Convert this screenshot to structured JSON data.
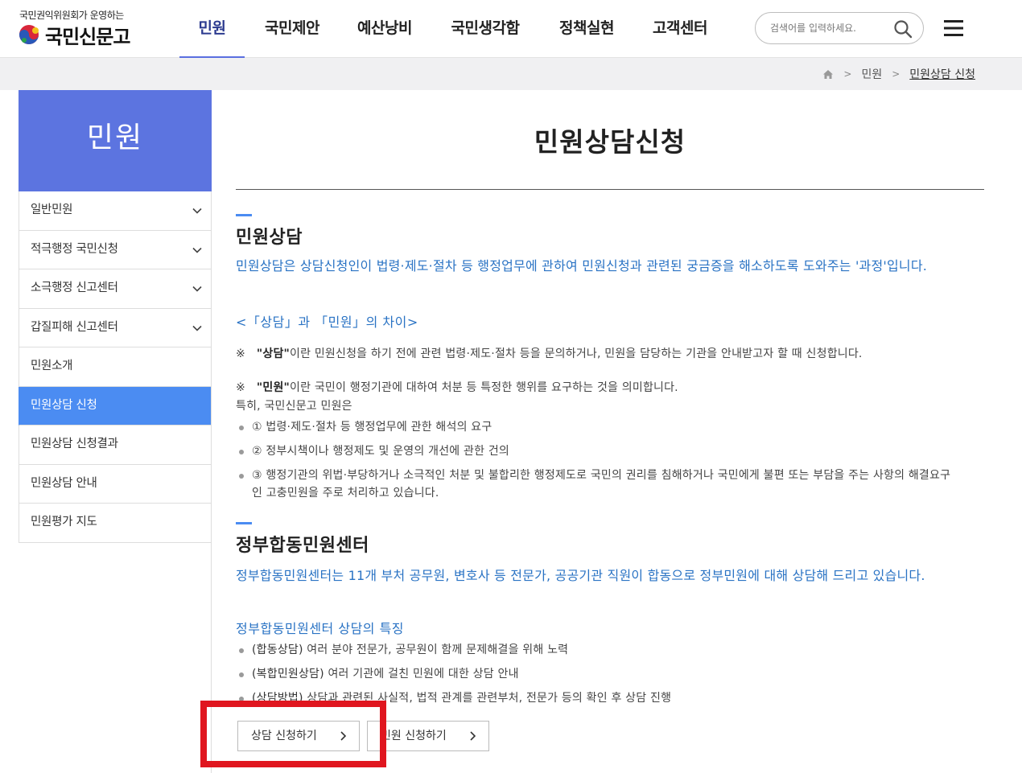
{
  "logo": {
    "subtitle": "국민권익위원회가 운영하는",
    "name": "국민신문고"
  },
  "nav": {
    "items": [
      {
        "label": "민원",
        "active": true
      },
      {
        "label": "국민제안",
        "active": false
      },
      {
        "label": "예산낭비",
        "active": false
      },
      {
        "label": "국민생각함",
        "active": false
      },
      {
        "label": "정책실현",
        "active": false
      },
      {
        "label": "고객센터",
        "active": false
      }
    ]
  },
  "search": {
    "placeholder": "검색어를 입력하세요.",
    "icon": "search-icon"
  },
  "breadcrumb": {
    "home_icon": "home-icon",
    "level1": "민원",
    "current": "민원상담 신청"
  },
  "sidebar": {
    "title": "민원",
    "items": [
      {
        "label": "일반민원",
        "expandable": true
      },
      {
        "label": "적극행정 국민신청",
        "expandable": true
      },
      {
        "label": "소극행정 신고센터",
        "expandable": true
      },
      {
        "label": "갑질피해 신고센터",
        "expandable": true
      },
      {
        "label": "민원소개",
        "expandable": false
      },
      {
        "label": "민원상담 신청",
        "expandable": false,
        "active": true
      },
      {
        "label": "민원상담 신청결과",
        "expandable": false
      },
      {
        "label": "민원상담 안내",
        "expandable": false
      },
      {
        "label": "민원평가 지도",
        "expandable": false
      }
    ]
  },
  "main": {
    "page_title": "민원상담신청",
    "section1": {
      "title": "민원상담",
      "description": "민원상담은 상담신청인이 법령·제도·절차 등 행정업무에 관하여 민원신청과 관련된 궁금증을 해소하도록 도와주는 '과정'입니다.",
      "diff_heading": "<「상담」과 「민원」의 차이>",
      "note1_mark": "※",
      "note1_bold": "\"상담\"",
      "note1_text": "이란 민원신청을 하기 전에 관련 법령·제도·절차 등을 문의하거나, 민원을 담당하는 기관을 안내받고자 할 때 신청합니다.",
      "note2_mark": "※",
      "note2_bold": "\"민원\"",
      "note2_text": "이란 국민이 행정기관에 대하여 처분 등 특정한 행위를 요구하는 것을 의미합니다.",
      "note2_extra": "특히, 국민신문고 민원은",
      "bullets": [
        "① 법령·제도·절차 등 행정업무에 관한 해석의 요구",
        "② 정부시책이나 행정제도 및 운영의 개선에 관한 건의",
        "③ 행정기관의 위법·부당하거나 소극적인 처분 및 불합리한 행정제도로 국민의 권리를 침해하거나 국민에게 불편 또는 부담을 주는 사항의 해결요구인 고충민원을 주로 처리하고 있습니다."
      ]
    },
    "section2": {
      "title": "정부합동민원센터",
      "description": "정부합동민원센터는 11개 부처 공무원, 변호사 등 전문가, 공공기관 직원이 합동으로 정부민원에 대해 상담해 드리고 있습니다.",
      "feature_heading": "정부합동민원센터 상담의 특징",
      "features": [
        {
          "bold": "(합동상담)",
          "text": " 여러 분야 전문가, 공무원이 함께 문제해결을 위해 노력"
        },
        {
          "bold": "(복합민원상담)",
          "text": " 여러 기관에 걸친 민원에 대한 상담 안내"
        },
        {
          "bold": "(상담방법)",
          "text": " 상담과 관련된 사실적, 법적 관계를 관련부처, 전문가 등의 확인 후 상담 진행"
        }
      ]
    },
    "buttons": {
      "consult": "상담 신청하기",
      "petition": "민원 신청하기"
    }
  },
  "colors": {
    "sidebar_title_bg": "#5c74e0",
    "sidebar_active_bg": "#4b8cf2",
    "link_blue": "#2a73c4",
    "highlight_red": "#e0161f"
  }
}
